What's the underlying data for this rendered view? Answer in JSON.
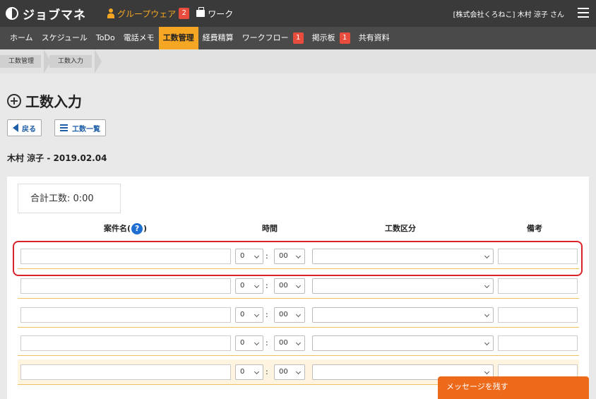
{
  "header": {
    "logo_text": "ジョブマネ",
    "groupware_label": "グループウェア",
    "groupware_badge": "2",
    "work_label": "ワーク",
    "user_label": "[株式会社くろねこ] 木村 涼子 さん"
  },
  "nav": [
    {
      "label": "ホーム",
      "active": false
    },
    {
      "label": "スケジュール",
      "active": false
    },
    {
      "label": "ToDo",
      "active": false
    },
    {
      "label": "電話メモ",
      "active": false
    },
    {
      "label": "工数管理",
      "active": true
    },
    {
      "label": "経費精算",
      "active": false
    },
    {
      "label": "ワークフロー",
      "active": false,
      "badge": "1"
    },
    {
      "label": "掲示板",
      "active": false,
      "badge": "1"
    },
    {
      "label": "共有資料",
      "active": false
    }
  ],
  "breadcrumb": [
    "工数管理",
    "工数入力"
  ],
  "page": {
    "title": "工数入力",
    "back_label": "戻る",
    "list_label": "工数一覧",
    "user_date": "木村 涼子 - 2019.02.04",
    "total_label": "合計工数: 0:00"
  },
  "table": {
    "headers": {
      "project": "案件名(",
      "project_close": ")",
      "help": "?",
      "time": "時間",
      "category": "工数区分",
      "note": "備考"
    },
    "rows": [
      {
        "hours": "0",
        "minutes": "00",
        "category": ""
      },
      {
        "hours": "0",
        "minutes": "00",
        "category": ""
      },
      {
        "hours": "0",
        "minutes": "00",
        "category": ""
      },
      {
        "hours": "0",
        "minutes": "00",
        "category": ""
      },
      {
        "hours": "0",
        "minutes": "00",
        "category": ""
      }
    ]
  },
  "message_button": "メッセージを残す",
  "colors": {
    "accent": "#f5a623",
    "badge": "#e74c3c",
    "highlight": "#d8232a",
    "message": "#ee6a1b"
  }
}
